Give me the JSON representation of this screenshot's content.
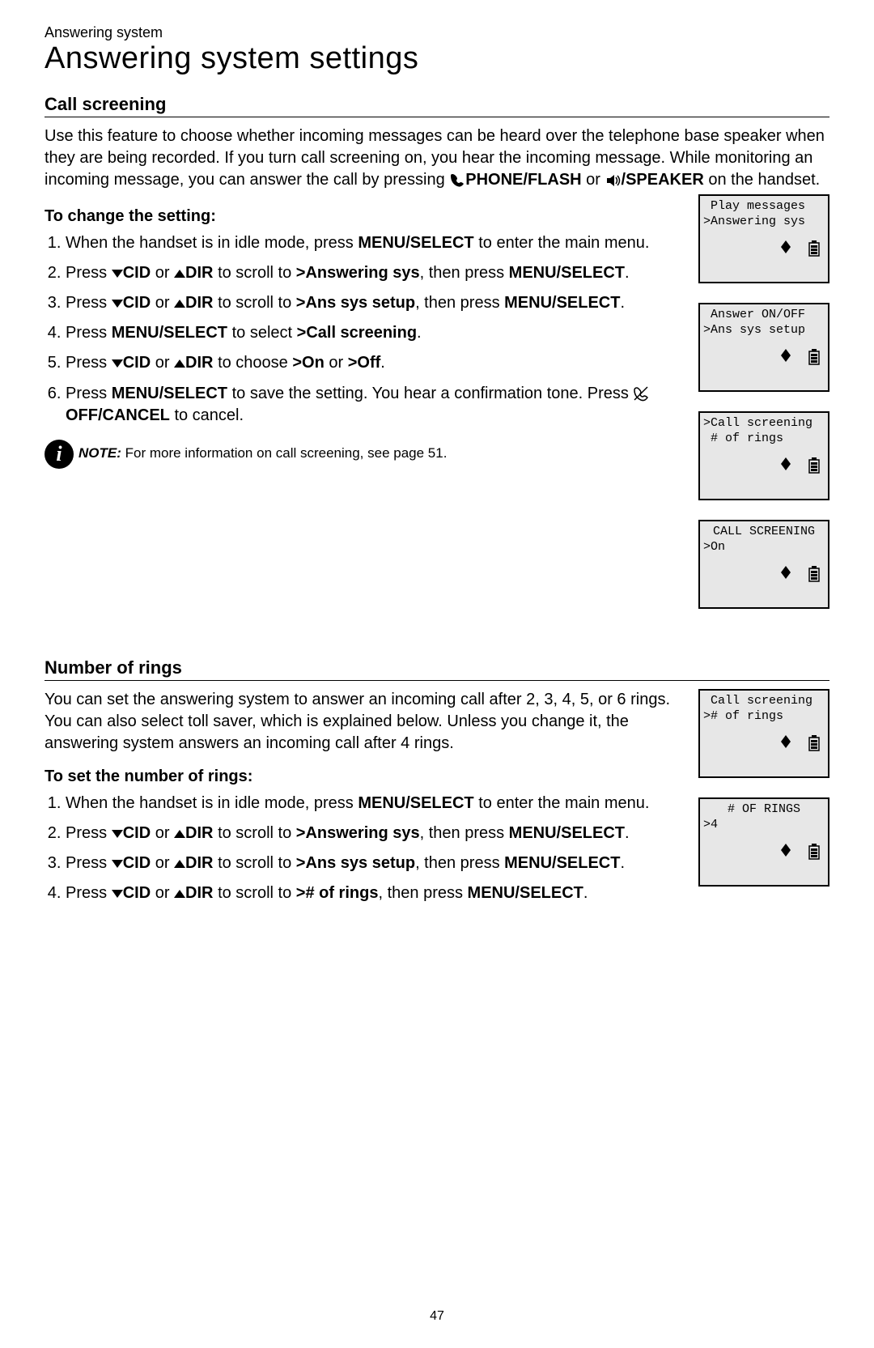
{
  "crumb": "Answering system",
  "title": "Answering system settings",
  "callScreening": {
    "heading": "Call screening",
    "intro_a": "Use this feature to choose whether incoming messages can be heard over the telephone base speaker when they are being recorded. If you turn call screening on, you hear the incoming message. While monitoring an incoming message, you can answer the call by pressing ",
    "phoneFlash": "PHONE/FLASH",
    "intro_or": " or ",
    "speaker": "/SPEAKER",
    "intro_b": " on the handset.",
    "changeHeading": "To change the setting:",
    "s1a": "When the handset is in idle mode, press ",
    "s1_menuSelect": "MENU/SELECT",
    "s1b": " to enter the main menu.",
    "s2a": "Press ",
    "s2_cid": "CID",
    "s2_or": " or ",
    "s2_dir": "DIR",
    "s2b": " to scroll to ",
    "s2_target": ">Answering sys",
    "s2c": ", then press ",
    "s2_menuSelect": "MENU/SELECT",
    "s2d": ".",
    "s3a": "Press ",
    "s3_cid": "CID",
    "s3_or": " or ",
    "s3_dir": "DIR",
    "s3b": " to scroll to ",
    "s3_target": ">Ans sys setup",
    "s3c": ", then press ",
    "s3_menuSelect": "MENU/SELECT",
    "s3d": ".",
    "s4a": "Press ",
    "s4_menuSelect": "MENU/SELECT",
    "s4b": " to select ",
    "s4_target": ">Call screening",
    "s4c": ".",
    "s5a": "Press ",
    "s5_cid": "CID",
    "s5_or": " or ",
    "s5_dir": "DIR",
    "s5b": " to choose ",
    "s5_on": ">On",
    "s5_or2": " or ",
    "s5_off": ">Off",
    "s5c": ".",
    "s6a": "Press ",
    "s6_menuSelect": "MENU/SELECT",
    "s6b": " to save the setting. You hear a confirmation tone. Press ",
    "s6_offCancel": "OFF/CANCEL",
    "s6c": " to cancel.",
    "note_label": "NOTE:",
    "note_text": " For more information on call screening, see page 51."
  },
  "lcds1": [
    {
      "l1": " Play messages",
      "l2": ">Answering sys",
      "l1c": false
    },
    {
      "l1": " Answer ON/OFF",
      "l2": ">Ans sys setup",
      "l1c": false
    },
    {
      "l1": ">Call screening",
      "l2": " # of rings",
      "l1c": false
    },
    {
      "l1": "CALL SCREENING",
      "l2": ">On",
      "l1c": true
    }
  ],
  "rings": {
    "heading": "Number of rings",
    "intro": "You can set the answering system to answer an incoming call after 2, 3, 4, 5, or 6 rings. You can also select toll saver, which is explained below. Unless you change it, the answering system answers an incoming call after 4 rings.",
    "setHeading": "To set the number of rings:",
    "s1a": "When the handset is in idle mode, press ",
    "s1_menuSelect": "MENU/SELECT",
    "s1b": " to enter the main menu.",
    "s2a": "Press ",
    "s2_cid": "CID",
    "s2_or": " or ",
    "s2_dir": "DIR",
    "s2b": " to scroll to ",
    "s2_target": ">Answering sys",
    "s2c": ", then press ",
    "s2_menuSelect": "MENU/SELECT",
    "s2d": ".",
    "s3a": "Press ",
    "s3_cid": "CID",
    "s3_or": " or ",
    "s3_dir": "DIR",
    "s3b": " to scroll to ",
    "s3_target": ">Ans sys setup",
    "s3c": ", then press ",
    "s3_menuSelect": "MENU/SELECT",
    "s3d": ".",
    "s4a": "Press ",
    "s4_cid": "CID",
    "s4_or": " or ",
    "s4_dir": "DIR",
    "s4b": " to scroll to ",
    "s4_target": "># of rings",
    "s4c": ", then press ",
    "s4_menuSelect": "MENU/SELECT",
    "s4d": "."
  },
  "lcds2": [
    {
      "l1": " Call screening",
      "l2": "># of rings",
      "l1c": false
    },
    {
      "l1": "# OF RINGS",
      "l2": ">4",
      "l1c": true
    }
  ],
  "pageNumber": "47"
}
